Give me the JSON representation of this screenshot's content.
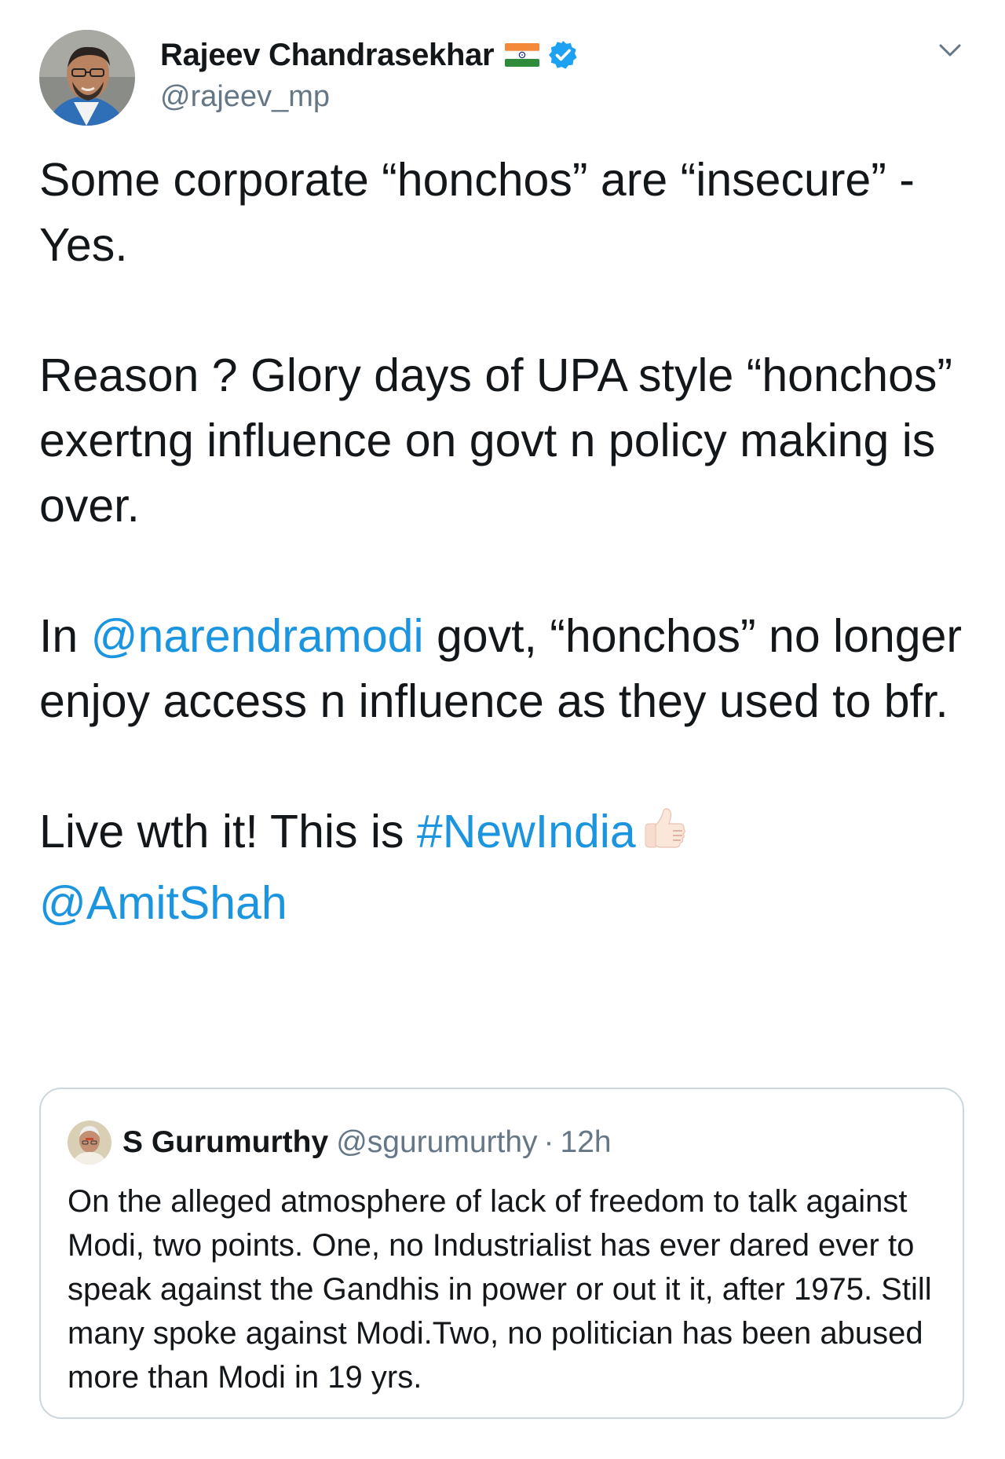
{
  "tweet": {
    "author": {
      "display_name": "Rajeev Chandrasekhar",
      "handle": "@rajeev_mp",
      "flag_icon": "india-flag-emoji",
      "verified_icon": "verified-badge-icon"
    },
    "menu_icon": "chevron-down-icon",
    "body": {
      "p1": "Some corporate “honchos” are “insecure” - Yes.",
      "p2": "Reason ? Glory days of UPA style “honchos” exertng influence on govt n policy making is over.",
      "p3": {
        "before": "In ",
        "mention": "@narendramodi",
        "after": " govt, “honchos” no longer enjoy access n influence as they used to bfr."
      },
      "p4": {
        "before": "Live wth it! This is ",
        "hashtag": "#NewIndia",
        "emoji": "thumbs-up-emoji",
        "mention": "@AmitShah"
      }
    },
    "quoted_tweet": {
      "display_name": "S Gurumurthy",
      "handle": "@sgurumurthy",
      "separator": "·",
      "time": "12h",
      "text": "On the alleged atmosphere of lack of freedom to talk against Modi, two points. One, no Industrialist has ever dared ever to speak against the Gandhis in power or out it it, after 1975. Still many spoke against Modi.Two, no politician has been abused more than Modi in 19 yrs."
    }
  },
  "colors": {
    "link": "#1b95e0",
    "text": "#14171a",
    "secondary": "#657786",
    "border": "#ccd6dd",
    "verified": "#1da1f2"
  }
}
